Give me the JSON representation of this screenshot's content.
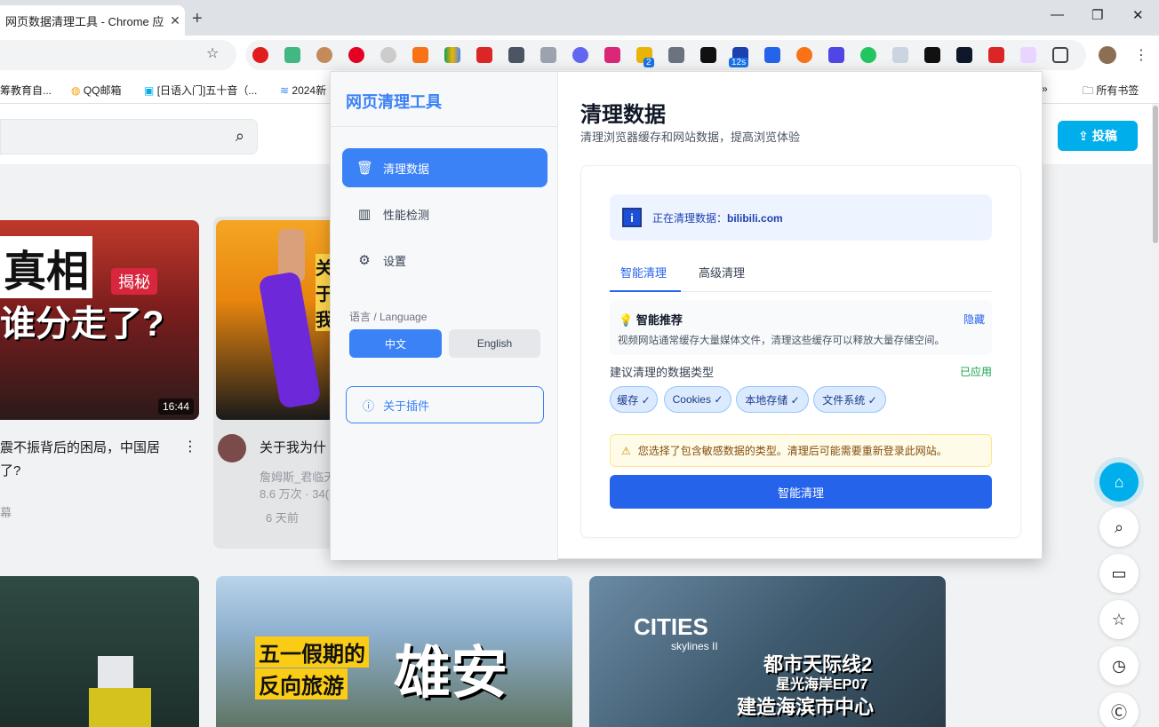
{
  "browser": {
    "tab_title": "网页数据清理工具 - Chrome 应",
    "bookmarks": [
      "筹教育自...",
      "QQ邮箱",
      "[日语入门]五十音（...",
      "2024新"
    ],
    "bookmarks_more": "»",
    "all_bookmarks": "所有书签",
    "badges": {
      "ext_badge_a": "2",
      "ext_badge_b": "12s"
    }
  },
  "page": {
    "upload_label": "投稿",
    "duration_1": "16:44",
    "thumb_text_1a": "真相",
    "thumb_text_1b": "谁分走了?",
    "thumb_badge_1": "揭秘",
    "thumb_text_2": "关于我",
    "video1_title_line1": "震不振背后的困局，中国居",
    "video1_title_line2": "了?",
    "video1_meta": "幕",
    "video2_title": "关于我为什",
    "video2_author": "詹姆斯_君临天",
    "video2_stats": "8.6 万次 · 34(",
    "video2_age": "6 天前",
    "thumb_text_4a": "五一假期的",
    "thumb_text_4b": "反向旅游",
    "thumb_text_4c": "雄安",
    "thumb_text_5a": "CITIES",
    "thumb_text_5b": "skylines II",
    "thumb_text_5c": "都市天际线2",
    "thumb_text_5d": "星光海岸EP07",
    "thumb_text_5e": "建造海滨市中心"
  },
  "popup": {
    "logo": "网页清理工具",
    "nav": [
      {
        "label": "清理数据",
        "icon": "trash-icon",
        "active": true
      },
      {
        "label": "性能检测",
        "icon": "bar-chart-icon",
        "active": false
      },
      {
        "label": "设置",
        "icon": "gear-icon",
        "active": false
      }
    ],
    "language_label": "语言 / Language",
    "lang_zh": "中文",
    "lang_en": "English",
    "about": "关于插件",
    "title": "清理数据",
    "subtitle": "清理浏览器缓存和网站数据，提高浏览体验",
    "info_prefix": "正在清理数据：",
    "info_site": "bilibili.com",
    "tab_smart": "智能清理",
    "tab_advanced": "高级清理",
    "rec_title": "智能推荐",
    "rec_hide": "隐藏",
    "rec_desc": "视频网站通常缓存大量媒体文件，清理这些缓存可以释放大量存储空间。",
    "suggest_label": "建议清理的数据类型",
    "applied": "已应用",
    "chips": [
      "缓存 ✓",
      "Cookies ✓",
      "本地存储 ✓",
      "文件系统 ✓"
    ],
    "warning": "您选择了包含敏感数据的类型。清理后可能需要重新登录此网站。",
    "cta": "智能清理"
  },
  "colors": {
    "accent": "#3b82f6",
    "cta": "#2563eb",
    "bili_blue": "#00aeec"
  }
}
